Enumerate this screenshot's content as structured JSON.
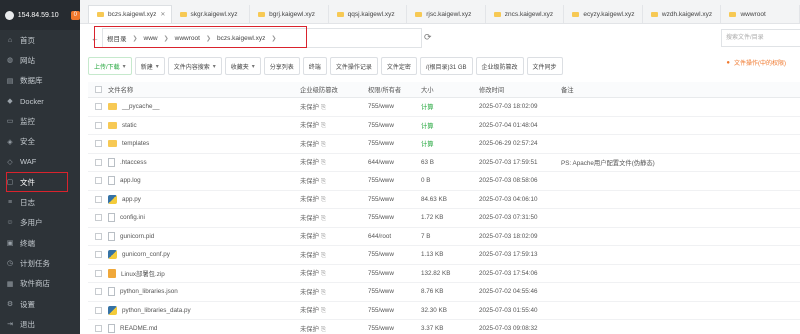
{
  "sidebar": {
    "server": "154.84.59.10",
    "badge": "0",
    "items": [
      {
        "icon": "home-icon",
        "label": "首页"
      },
      {
        "icon": "globe-icon",
        "label": "网站"
      },
      {
        "icon": "database-icon",
        "label": "数据库"
      },
      {
        "icon": "docker-icon",
        "label": "Docker"
      },
      {
        "icon": "monitor-icon",
        "label": "监控"
      },
      {
        "icon": "shield-icon",
        "label": "安全"
      },
      {
        "icon": "waf-icon",
        "label": "WAF"
      },
      {
        "icon": "folder-icon",
        "label": "文件"
      },
      {
        "icon": "log-icon",
        "label": "日志"
      },
      {
        "icon": "users-icon",
        "label": "多用户"
      },
      {
        "icon": "terminal-icon",
        "label": "终端"
      },
      {
        "icon": "clock-icon",
        "label": "计划任务"
      },
      {
        "icon": "store-icon",
        "label": "软件商店"
      },
      {
        "icon": "gear-icon",
        "label": "设置"
      },
      {
        "icon": "logout-icon",
        "label": "退出"
      }
    ]
  },
  "tabs": [
    "bczs.kaigewl.xyz",
    "skgr.kaigewl.xyz",
    "bgrj.kaigewl.xyz",
    "qqsj.kaigewl.xyz",
    "rjsc.kaigewl.xyz",
    "zncs.kaigewl.xyz",
    "ecyzy.kaigewl.xyz",
    "wzdh.kaigewl.xyz",
    "wwwroot"
  ],
  "breadcrumb": [
    "根目录",
    "www",
    "wwwroot",
    "bczs.kaigewl.xyz"
  ],
  "search_placeholder": "搜索文件/目录",
  "toolbar": [
    "上传/下载",
    "新建",
    "文件内容搜索",
    "收藏夹",
    "分享列表",
    "终端",
    "文件操作记录",
    "文件定密",
    "/(根目录)31 GB",
    "企业级防篡改",
    "文件同步"
  ],
  "toolbar_right": "文件操作(中的权限)",
  "columns": {
    "name": "文件名称",
    "prot": "企业级防篡改",
    "perm": "权限/所有者",
    "size": "大小",
    "time": "修改时间",
    "note": "备注"
  },
  "files": [
    {
      "type": "folder",
      "name": "__pycache__",
      "prot": "未保护",
      "perm": "755/www",
      "size": "计算",
      "time": "2025-07-03 18:02:09",
      "note": ""
    },
    {
      "type": "folder",
      "name": "static",
      "prot": "未保护",
      "perm": "755/www",
      "size": "计算",
      "time": "2025-07-04 01:48:04",
      "note": ""
    },
    {
      "type": "folder",
      "name": "templates",
      "prot": "未保护",
      "perm": "755/www",
      "size": "计算",
      "time": "2025-06-29 02:57:24",
      "note": ""
    },
    {
      "type": "file",
      "name": ".htaccess",
      "prot": "未保护",
      "perm": "644/www",
      "size": "63 B",
      "time": "2025-07-03 17:59:51",
      "note": "PS: Apache用户配置文件(伪静态)"
    },
    {
      "type": "file",
      "name": "app.log",
      "prot": "未保护",
      "perm": "755/www",
      "size": "0 B",
      "time": "2025-07-03 08:58:06",
      "note": ""
    },
    {
      "type": "py",
      "name": "app.py",
      "prot": "未保护",
      "perm": "755/www",
      "size": "84.63 KB",
      "time": "2025-07-03 04:06:10",
      "note": ""
    },
    {
      "type": "file",
      "name": "config.ini",
      "prot": "未保护",
      "perm": "755/www",
      "size": "1.72 KB",
      "time": "2025-07-03 07:31:50",
      "note": ""
    },
    {
      "type": "pid",
      "name": "gunicorn.pid",
      "prot": "未保护",
      "perm": "644/root",
      "size": "7 B",
      "time": "2025-07-03 18:02:09",
      "note": ""
    },
    {
      "type": "py",
      "name": "gunicorn_conf.py",
      "prot": "未保护",
      "perm": "755/www",
      "size": "1.13 KB",
      "time": "2025-07-03 17:59:13",
      "note": ""
    },
    {
      "type": "zip",
      "name": "Linux部署包.zip",
      "prot": "未保护",
      "perm": "755/www",
      "size": "132.82 KB",
      "time": "2025-07-03 17:54:06",
      "note": ""
    },
    {
      "type": "file",
      "name": "python_libraries.json",
      "prot": "未保护",
      "perm": "755/www",
      "size": "8.76 KB",
      "time": "2025-07-02 04:55:46",
      "note": ""
    },
    {
      "type": "py",
      "name": "python_libraries_data.py",
      "prot": "未保护",
      "perm": "755/www",
      "size": "32.30 KB",
      "time": "2025-07-03 01:55:40",
      "note": ""
    },
    {
      "type": "file",
      "name": "README.md",
      "prot": "未保护",
      "perm": "755/www",
      "size": "3.37 KB",
      "time": "2025-07-03 09:08:32",
      "note": ""
    }
  ]
}
